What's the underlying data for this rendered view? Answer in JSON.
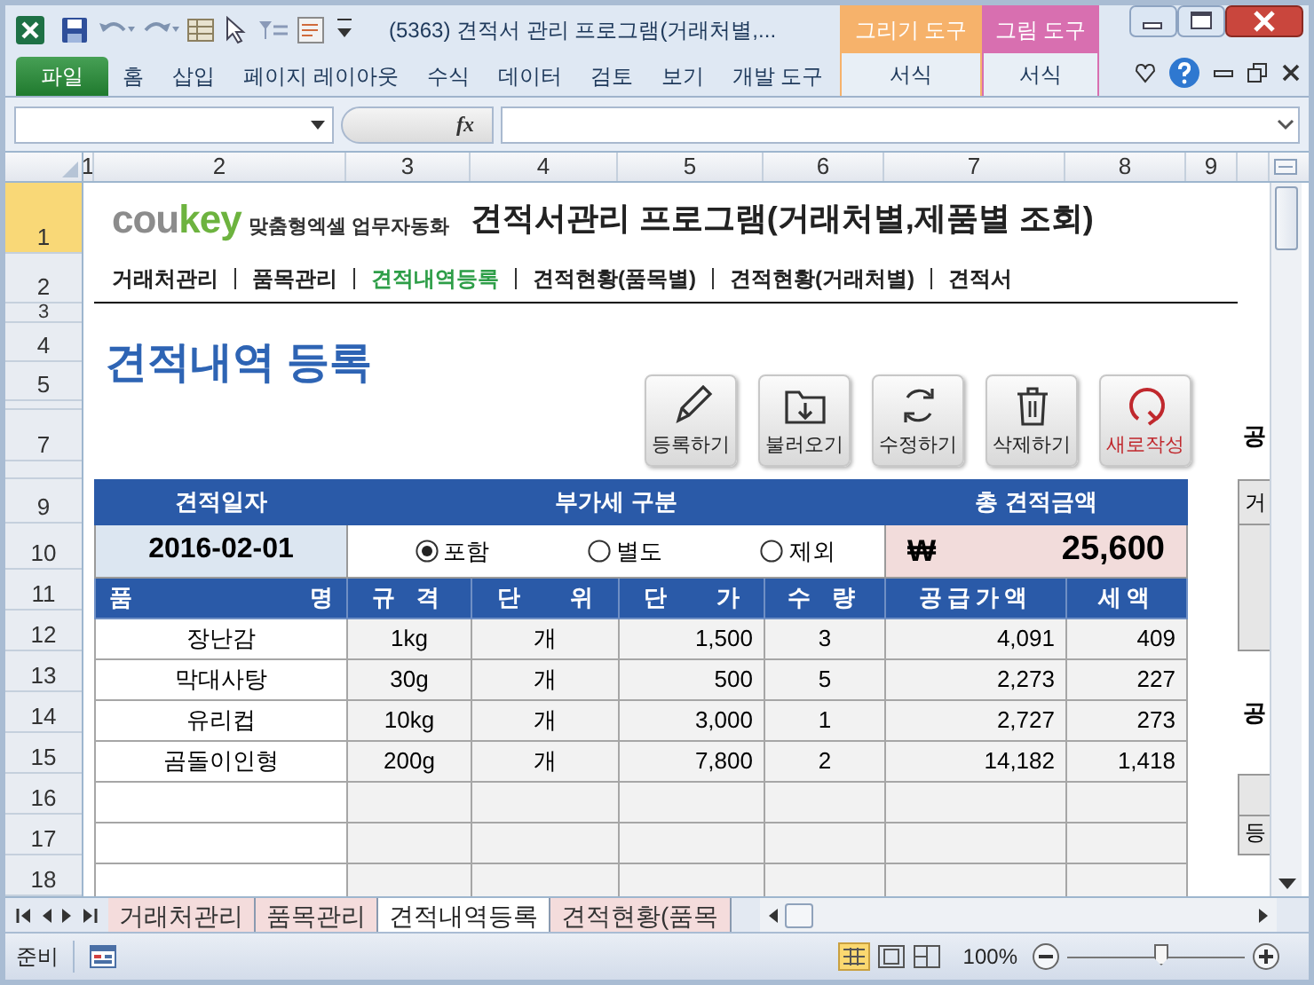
{
  "window": {
    "title": "(5363) 견적서 관리 프로그램(거래처별,...",
    "contextual_tabs": [
      {
        "label": "그리기 도구",
        "tab": "서식",
        "color": "#f6b26b"
      },
      {
        "label": "그림 도구",
        "tab": "서식",
        "color": "#d86fb0"
      }
    ]
  },
  "ribbon": {
    "tabs": [
      {
        "label": "파일",
        "kind": "file"
      },
      {
        "label": "홈",
        "kind": "tab"
      },
      {
        "label": "삽입",
        "kind": "tab"
      },
      {
        "label": "페이지 레이아웃",
        "kind": "tab"
      },
      {
        "label": "수식",
        "kind": "tab"
      },
      {
        "label": "데이터",
        "kind": "tab"
      },
      {
        "label": "검토",
        "kind": "tab"
      },
      {
        "label": "보기",
        "kind": "tab"
      },
      {
        "label": "개발 도구",
        "kind": "tab"
      }
    ]
  },
  "formula_bar": {
    "fx": "fx"
  },
  "column_headers": [
    "1",
    "2",
    "3",
    "4",
    "5",
    "6",
    "7",
    "8",
    "9"
  ],
  "row_headers": [
    {
      "label": "1",
      "selected": true
    },
    {
      "label": "2",
      "selected": false
    },
    {
      "label": "3",
      "selected": false
    },
    {
      "label": "4",
      "selected": false
    },
    {
      "label": "5",
      "selected": false
    },
    {
      "selected": false
    },
    {
      "label": "7",
      "selected": false
    },
    {
      "selected": false
    },
    {
      "label": "9",
      "selected": false
    },
    {
      "label": "10",
      "selected": false
    },
    {
      "label": "11",
      "selected": false
    },
    {
      "label": "12",
      "selected": false
    },
    {
      "label": "13",
      "selected": false
    },
    {
      "label": "14",
      "selected": false
    },
    {
      "label": "15",
      "selected": false
    },
    {
      "label": "16",
      "selected": false
    },
    {
      "label": "17",
      "selected": false
    },
    {
      "label": "18",
      "selected": false
    }
  ],
  "logo": {
    "parts": [
      {
        "text": "cou",
        "color": "#8c8c8c"
      },
      {
        "text": "key",
        "color": "#6db33f"
      }
    ],
    "tagline": "맞춤형엑셀 업무자동화"
  },
  "program_title": "견적서관리 프로그램(거래처별,제품별 조회)",
  "nav": [
    {
      "label": "거래처관리",
      "selected": false
    },
    {
      "label": "품목관리",
      "selected": false
    },
    {
      "label": "견적내역등록",
      "selected": true
    },
    {
      "label": "견적현황(품목별)",
      "selected": false
    },
    {
      "label": "견적현황(거래처별)",
      "selected": false
    },
    {
      "label": "견적서",
      "selected": false
    }
  ],
  "page_heading": "견적내역 등록",
  "action_buttons": [
    {
      "label": "등록하기",
      "kind": "pencil"
    },
    {
      "label": "불러오기",
      "kind": "folder"
    },
    {
      "label": "수정하기",
      "kind": "refresh"
    },
    {
      "label": "삭제하기",
      "kind": "trash"
    },
    {
      "label": "새로작성",
      "kind": "new"
    }
  ],
  "form": {
    "headers": [
      "견적일자",
      "부가세 구분",
      "총 견적금액"
    ],
    "date": "2016-02-01",
    "vat_options": [
      {
        "label": "포함",
        "selected": true
      },
      {
        "label": "별도",
        "selected": false
      },
      {
        "label": "제외",
        "selected": false
      }
    ],
    "currency": "₩",
    "total": "25,600"
  },
  "table": {
    "columns": [
      "품 명",
      "규 격",
      "단 위",
      "단 가",
      "수 량",
      "공급가액",
      "세액"
    ],
    "rows": [
      [
        "장난감",
        "1kg",
        "개",
        "1,500",
        "3",
        "4,091",
        "409"
      ],
      [
        "막대사탕",
        "30g",
        "개",
        "500",
        "5",
        "2,273",
        "227"
      ],
      [
        "유리컵",
        "10kg",
        "개",
        "3,000",
        "1",
        "2,727",
        "273"
      ],
      [
        "곰돌이인형",
        "200g",
        "개",
        "7,800",
        "2",
        "14,182",
        "1,418"
      ]
    ]
  },
  "side_panel": {
    "label_1": "공",
    "cell_1": "거",
    "label_2": "공",
    "cell_2": "등"
  },
  "sheet_tabs": [
    {
      "label": "거래처관리",
      "selected": false
    },
    {
      "label": "품목관리",
      "selected": false
    },
    {
      "label": "견적내역등록",
      "selected": true
    },
    {
      "label": "견적현황(품목",
      "selected": false
    }
  ],
  "status_bar": {
    "status": "준비",
    "zoom": "100%",
    "zoom_slider": {
      "level": 0.53
    }
  }
}
